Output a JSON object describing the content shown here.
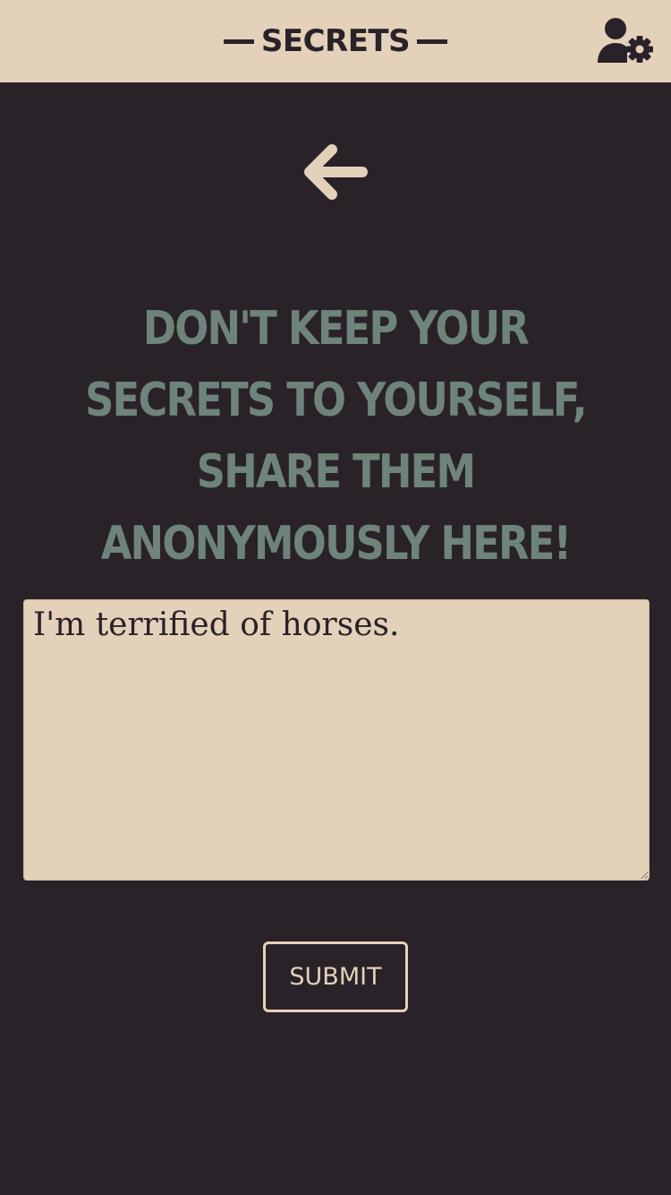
{
  "header": {
    "brand": "SECRETS"
  },
  "main": {
    "headline_line1": "Don't keep your secrets to yourself,",
    "headline_line2": "share them anonymously here!",
    "secret_value": "I'm terrified of horses.",
    "submit_label": "SUBMIT"
  },
  "icons": {
    "settings": "user-gear-icon",
    "back": "arrow-left-icon"
  },
  "colors": {
    "background": "#2a2229",
    "beige": "#e4d1b9",
    "headline": "#6e847b"
  }
}
